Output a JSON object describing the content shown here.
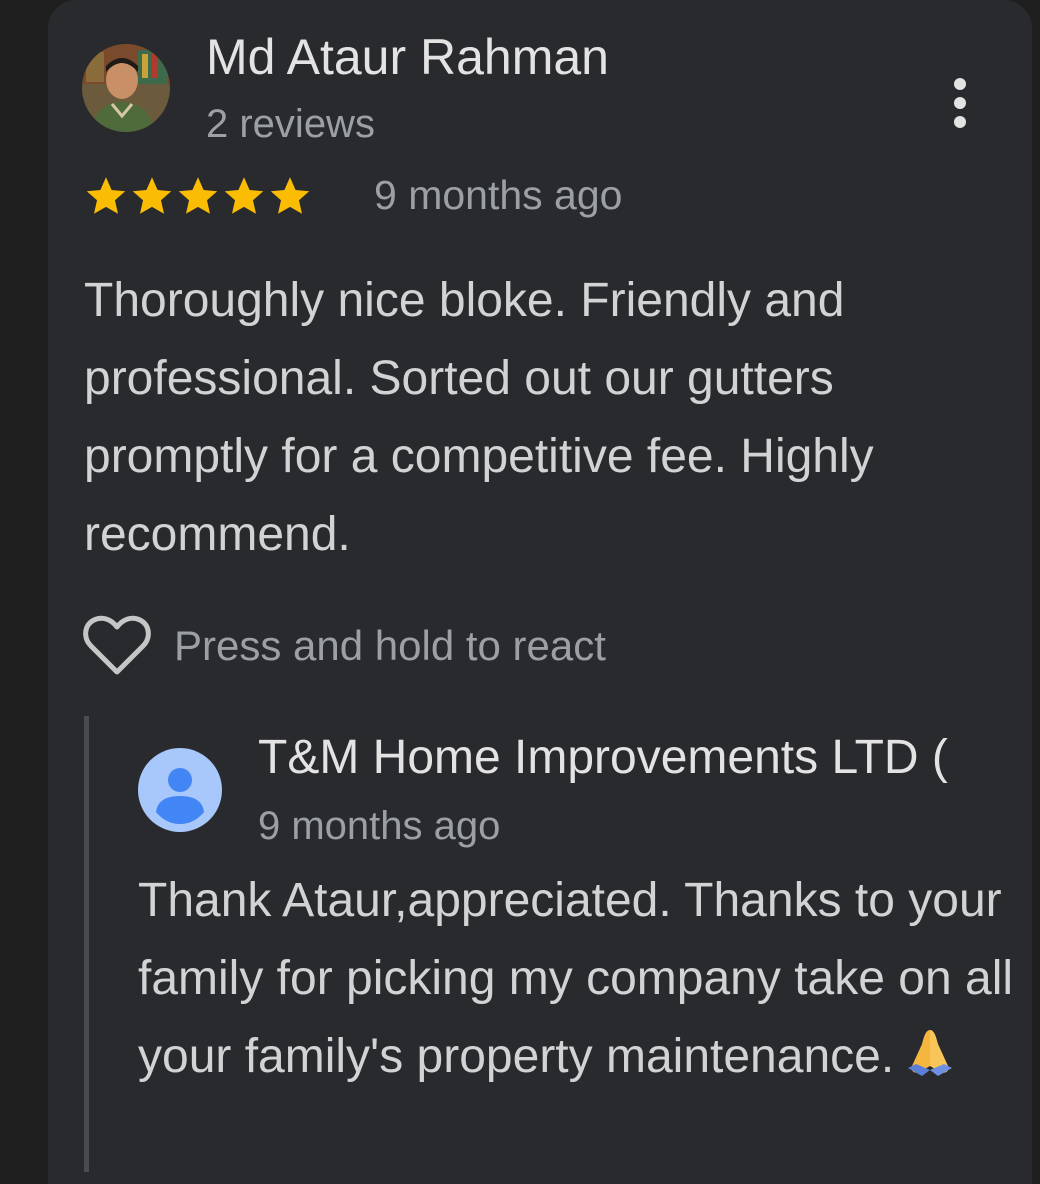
{
  "review": {
    "reviewer_name": "Md Ataur Rahman",
    "reviewer_meta": "2 reviews",
    "rating": 5,
    "rating_max": 5,
    "time": "9 months ago",
    "text": "Thoroughly nice bloke. Friendly and professional. Sorted out our gutters promptly for a competitive fee. Highly recommend.",
    "react_label": "Press and hold to react"
  },
  "reply": {
    "owner_name": "T&M Home Improvements LTD (",
    "time": "9 months ago",
    "text": "Thank Ataur,appreciated. Thanks to your family for picking my company take on all your family's property maintenance."
  },
  "icons": {
    "more": "more-vertical-icon",
    "star": "star-icon",
    "heart": "heart-outline-icon",
    "owner_avatar": "default-user-avatar-icon",
    "emoji": "folded-hands-emoji"
  },
  "colors": {
    "background": "#1f1f1f",
    "card": "#292a2d",
    "star": "#fbbc04",
    "primary_text": "#e3e3e3",
    "secondary_text": "#9aa0a6",
    "owner_avatar_bg": "#a8c7fa",
    "owner_avatar_fg": "#4285f4"
  }
}
